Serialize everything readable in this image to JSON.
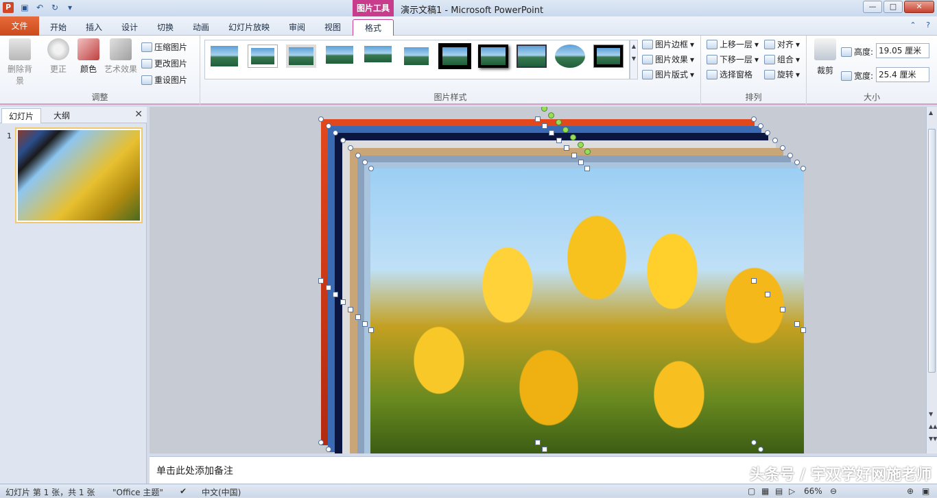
{
  "title_bar": {
    "context_tools": "图片工具",
    "title": "演示文稿1 - Microsoft PowerPoint",
    "app_icon": "P"
  },
  "tabs": {
    "file": "文件",
    "items": [
      "开始",
      "插入",
      "设计",
      "切换",
      "动画",
      "幻灯片放映",
      "审阅",
      "视图",
      "格式"
    ],
    "active": "格式"
  },
  "ribbon": {
    "adjust": {
      "label": "调整",
      "remove_bg": "删除背景",
      "corrections": "更正",
      "color": "颜色",
      "artistic": "艺术效果",
      "compress": "压缩图片",
      "change": "更改图片",
      "reset": "重设图片"
    },
    "styles": {
      "label": "图片样式",
      "border": "图片边框",
      "effects": "图片效果",
      "layout": "图片版式"
    },
    "arrange": {
      "label": "排列",
      "bring_forward": "上移一层",
      "send_backward": "下移一层",
      "selection_pane": "选择窗格",
      "align": "对齐",
      "group": "组合",
      "rotate": "旋转"
    },
    "size": {
      "label": "大小",
      "crop": "裁剪",
      "height_label": "高度:",
      "height_value": "19.05 厘米",
      "width_label": "宽度:",
      "width_value": "25.4 厘米"
    }
  },
  "left_pane": {
    "tab_slides": "幻灯片",
    "tab_outline": "大纲",
    "close": "✕",
    "slide_number": "1"
  },
  "notes": {
    "placeholder": "单击此处添加备注",
    "watermark": "头条号 / 宇双学好网施老师"
  },
  "status": {
    "slide_info": "幻灯片 第 1 张，共 1 张",
    "theme": "\"Office 主题\"",
    "language": "中文(中国)",
    "zoom": "66%"
  },
  "icons": {
    "save": "save-icon",
    "undo": "undo-icon",
    "redo": "redo-icon",
    "customize": "customize-qat-icon"
  }
}
